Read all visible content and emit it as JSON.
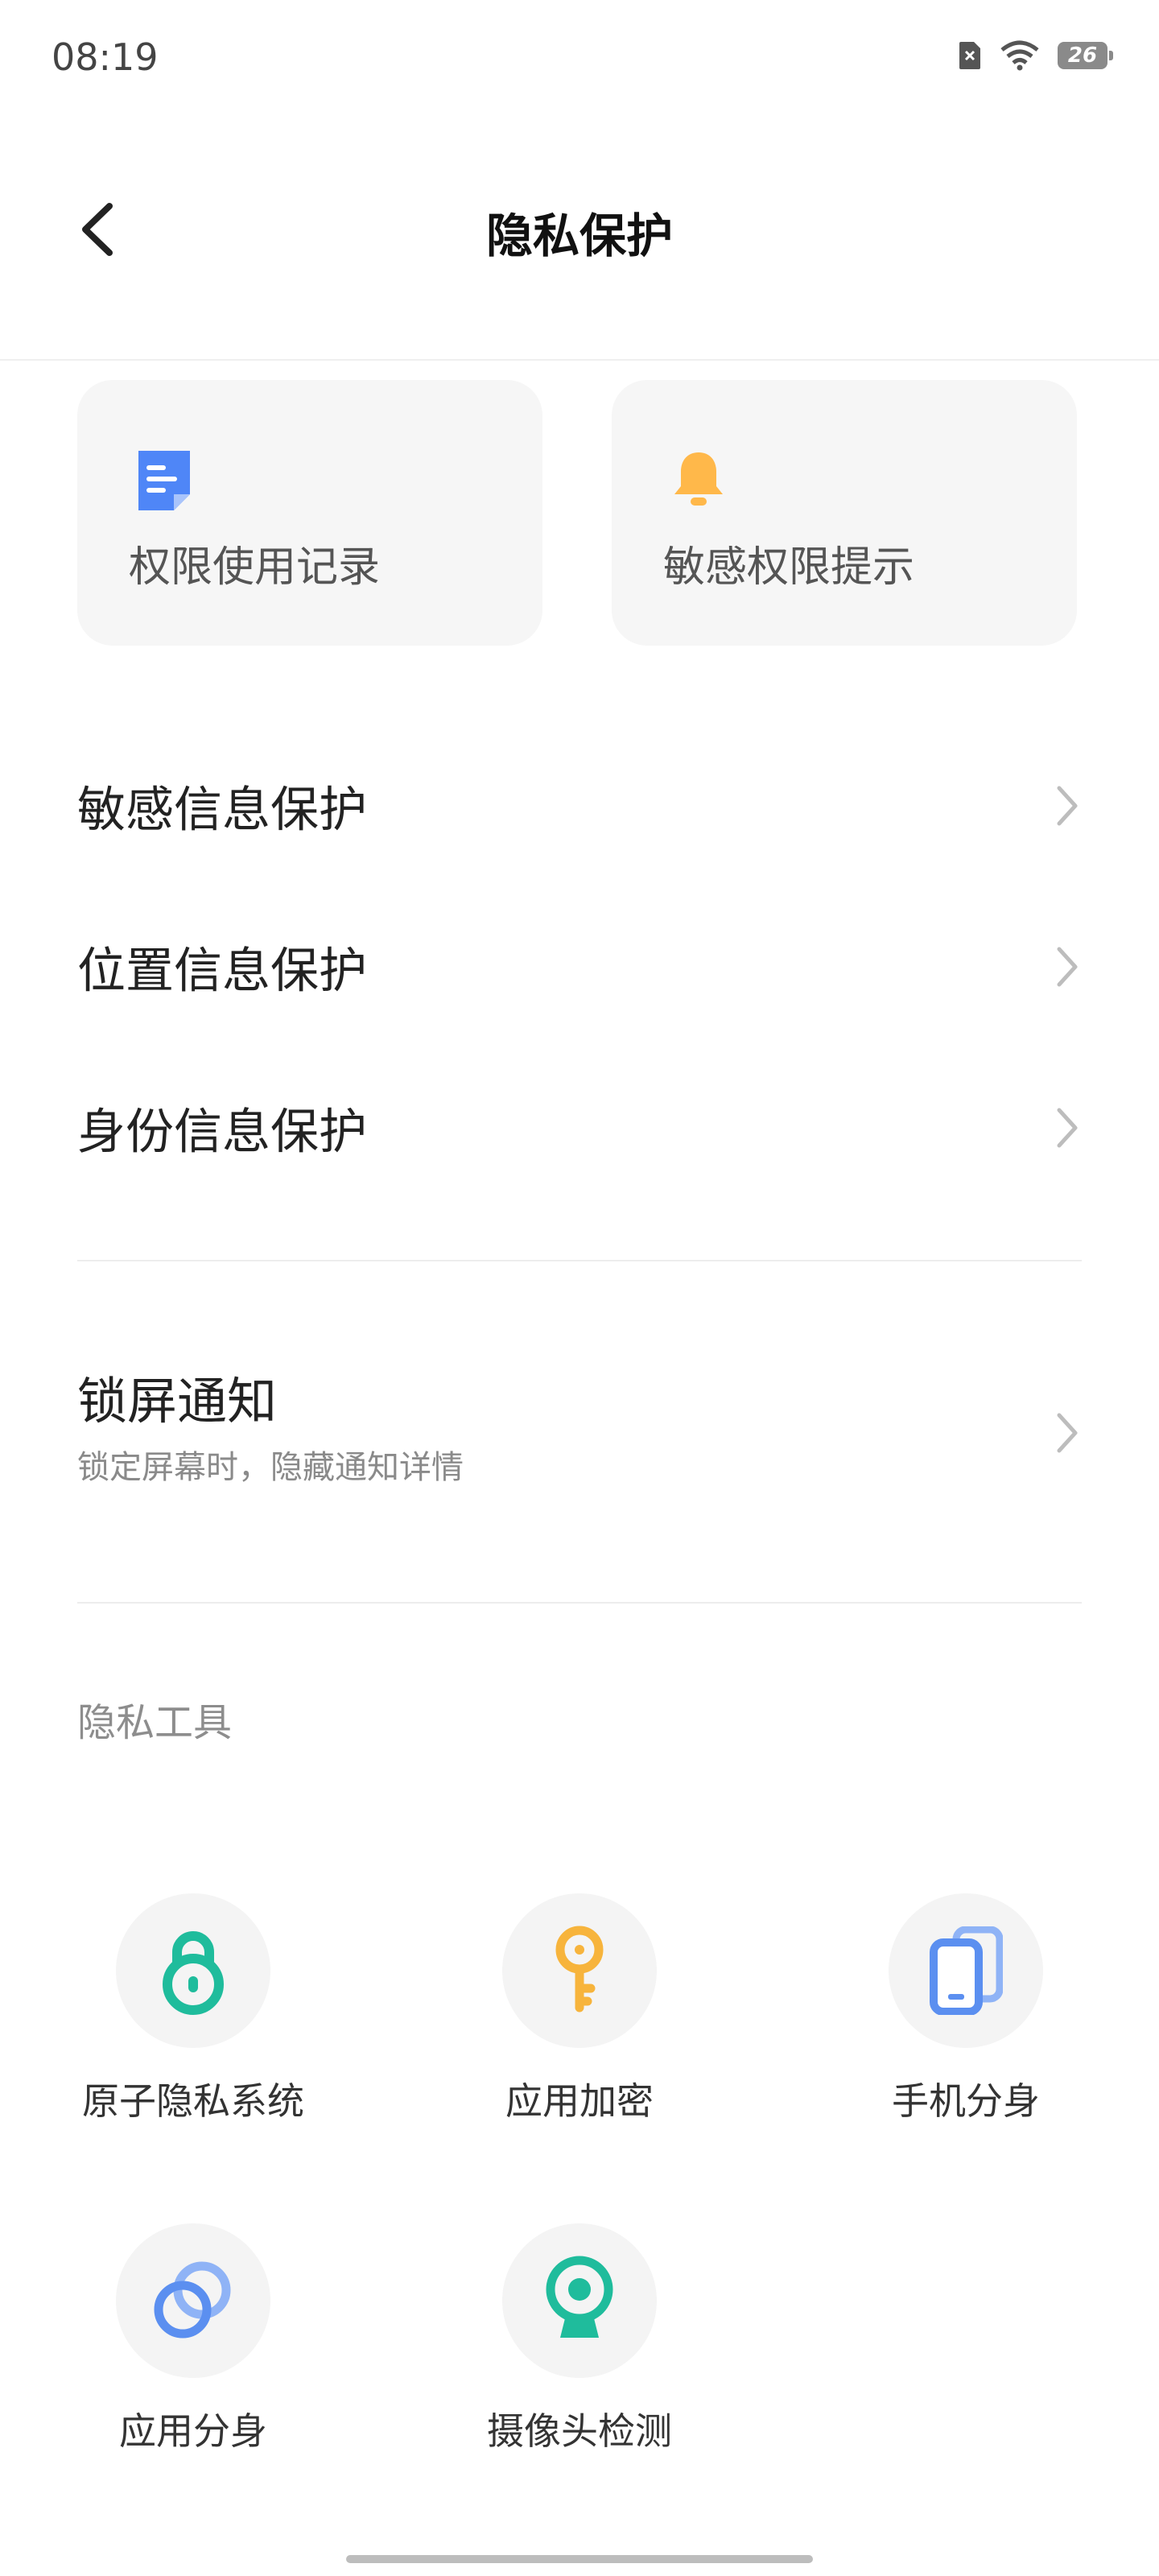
{
  "status_bar": {
    "time": "08:19",
    "battery": "26"
  },
  "header": {
    "title": "隐私保护"
  },
  "quick_cards": [
    {
      "label": "权限使用记录",
      "icon": "document-icon",
      "color": "#4f86f7"
    },
    {
      "label": "敏感权限提示",
      "icon": "bell-icon",
      "color": "#ffb84a"
    }
  ],
  "list": [
    {
      "label": "敏感信息保护"
    },
    {
      "label": "位置信息保护"
    },
    {
      "label": "身份信息保护"
    }
  ],
  "lock_screen": {
    "title": "锁屏通知",
    "subtitle": "锁定屏幕时，隐藏通知详情"
  },
  "privacy_tools": {
    "section_title": "隐私工具",
    "items": [
      {
        "label": "原子隐私系统",
        "icon": "lock-icon",
        "color": "#1fbc9c"
      },
      {
        "label": "应用加密",
        "icon": "key-icon",
        "color": "#f7b43c"
      },
      {
        "label": "手机分身",
        "icon": "phone-clone-icon",
        "color": "#5b8ff0"
      },
      {
        "label": "应用分身",
        "icon": "link-rings-icon",
        "color": "#5b8ff0"
      },
      {
        "label": "摄像头检测",
        "icon": "camera-icon",
        "color": "#1fbc9c"
      }
    ]
  }
}
